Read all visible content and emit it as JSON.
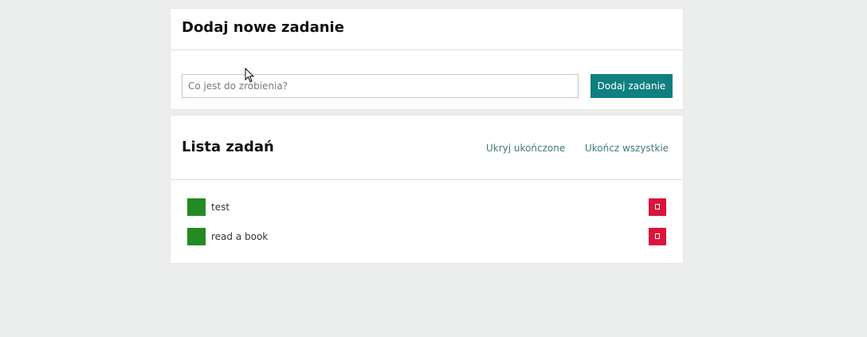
{
  "add_panel": {
    "title": "Dodaj nowe zadanie",
    "input_value": "",
    "input_placeholder": "Co jest do zrobienia?",
    "add_button_label": "Dodaj zadanie"
  },
  "list_panel": {
    "title": "Lista zadań",
    "hide_completed_label": "Ukryj ukończone",
    "complete_all_label": "Ukończ wszystkie",
    "tasks": [
      {
        "label": "test",
        "check_icon": "green-square",
        "delete_icon": "trash-icon"
      },
      {
        "label": "read a book",
        "check_icon": "green-square",
        "delete_icon": "trash-icon"
      }
    ]
  },
  "colors": {
    "background": "#eceeed",
    "accent": "#0f7f7f",
    "link": "#3f7a77",
    "task_done": "#228b22",
    "delete": "#dc143c"
  }
}
